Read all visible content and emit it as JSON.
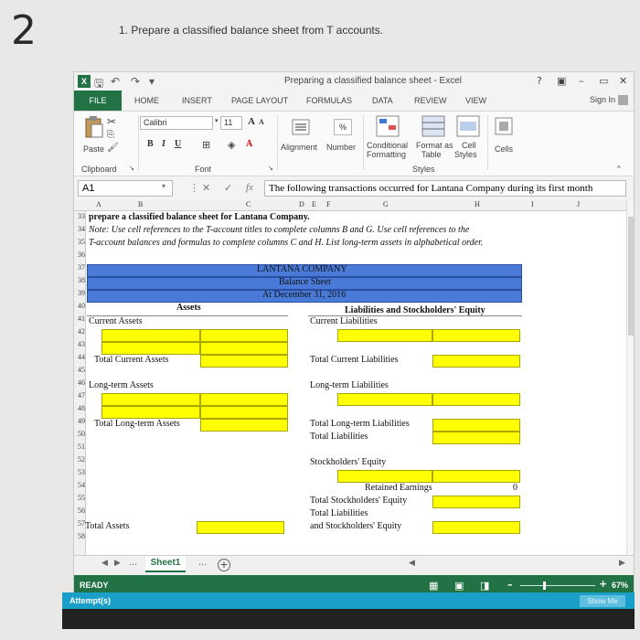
{
  "page_number": "2",
  "question": "1. Prepare a classified balance sheet from T accounts.",
  "excel": {
    "window_title": "Preparing a classified balance sheet - Excel",
    "title_controls": [
      "?",
      "▣",
      "–",
      "▭",
      "✕"
    ],
    "tabs": [
      "FILE",
      "HOME",
      "INSERT",
      "PAGE LAYOUT",
      "FORMULAS",
      "DATA",
      "REVIEW",
      "VIEW"
    ],
    "sign_in": "Sign In",
    "ribbon": {
      "paste": "Paste",
      "clipboard": "Clipboard",
      "font_name": "Calibri",
      "font_size": "11",
      "font_group": "Font",
      "bold": "B",
      "italic": "I",
      "underline": "U",
      "grow_font": "A",
      "shrink_font": "A",
      "alignment": "Alignment",
      "number": "Number",
      "percent": "%",
      "conditional": "Conditional",
      "formatting": "Formatting",
      "format_as": "Format as",
      "table": "Table",
      "cell": "Cell",
      "styles_btn": "Styles",
      "cells": "Cells",
      "styles_group": "Styles"
    },
    "formula_bar": {
      "name_box": "A1",
      "content": "The following transactions occurred for Lantana Company during its first month"
    },
    "columns": [
      "A",
      "B",
      "C",
      "D",
      "E",
      "F",
      "G",
      "H",
      "I",
      "J"
    ],
    "rows": [
      "33",
      "34",
      "35",
      "36",
      "37",
      "38",
      "39",
      "40",
      "41",
      "42",
      "43",
      "44",
      "45",
      "46",
      "47",
      "48",
      "49",
      "50",
      "51",
      "52",
      "53",
      "54",
      "55",
      "56",
      "57",
      "58"
    ],
    "instructions": {
      "line33": "prepare a classified balance sheet for Lantana Company.",
      "line34": "Note: Use cell references to the T-account titles to complete columns B and G. Use cell references to the",
      "line35": "T-account balances and formulas to complete columns C and H. List long-term assets in alphabetical order."
    },
    "sheet": {
      "company": "LANTANA COMPANY",
      "title": "Balance Sheet",
      "date": "At December 31, 2016",
      "assets_header": "Assets",
      "liab_header": "Liabilities and Stockholders' Equity",
      "current_assets": "Current Assets",
      "total_current_assets": "Total Current Assets",
      "long_term_assets": "Long-term Assets",
      "total_long_term_assets": "Total Long-term Assets",
      "total_assets": "Total Assets",
      "current_liabilities": "Current Liabilities",
      "total_current_liabilities": "Total Current Liabilities",
      "long_term_liabilities": "Long-term Liabilities",
      "total_long_term_liabilities": "Total Long-term Liabilities",
      "total_liabilities": "Total Liabilities",
      "stockholders_equity": "Stockholders' Equity",
      "retained_earnings": "Retained Earnings",
      "retained_earnings_value": "0",
      "total_stockholders_equity": "Total Stockholders' Equity",
      "total_liabilities_2": "Total Liabilities",
      "and_stockholders_equity": "and Stockholders' Equity"
    },
    "sheet_tab": "Sheet1",
    "sheet_more": "...",
    "status": "READY",
    "zoom": "67%",
    "zoom_level_percent": 67
  },
  "attempts_label": "Attempt(s)",
  "show_me": "Show Me",
  "colors": {
    "excel_green": "#217346",
    "header_blue": "#4a7ad8",
    "input_yellow": "#ffff00",
    "attempt_bar": "#1a9fc9"
  }
}
